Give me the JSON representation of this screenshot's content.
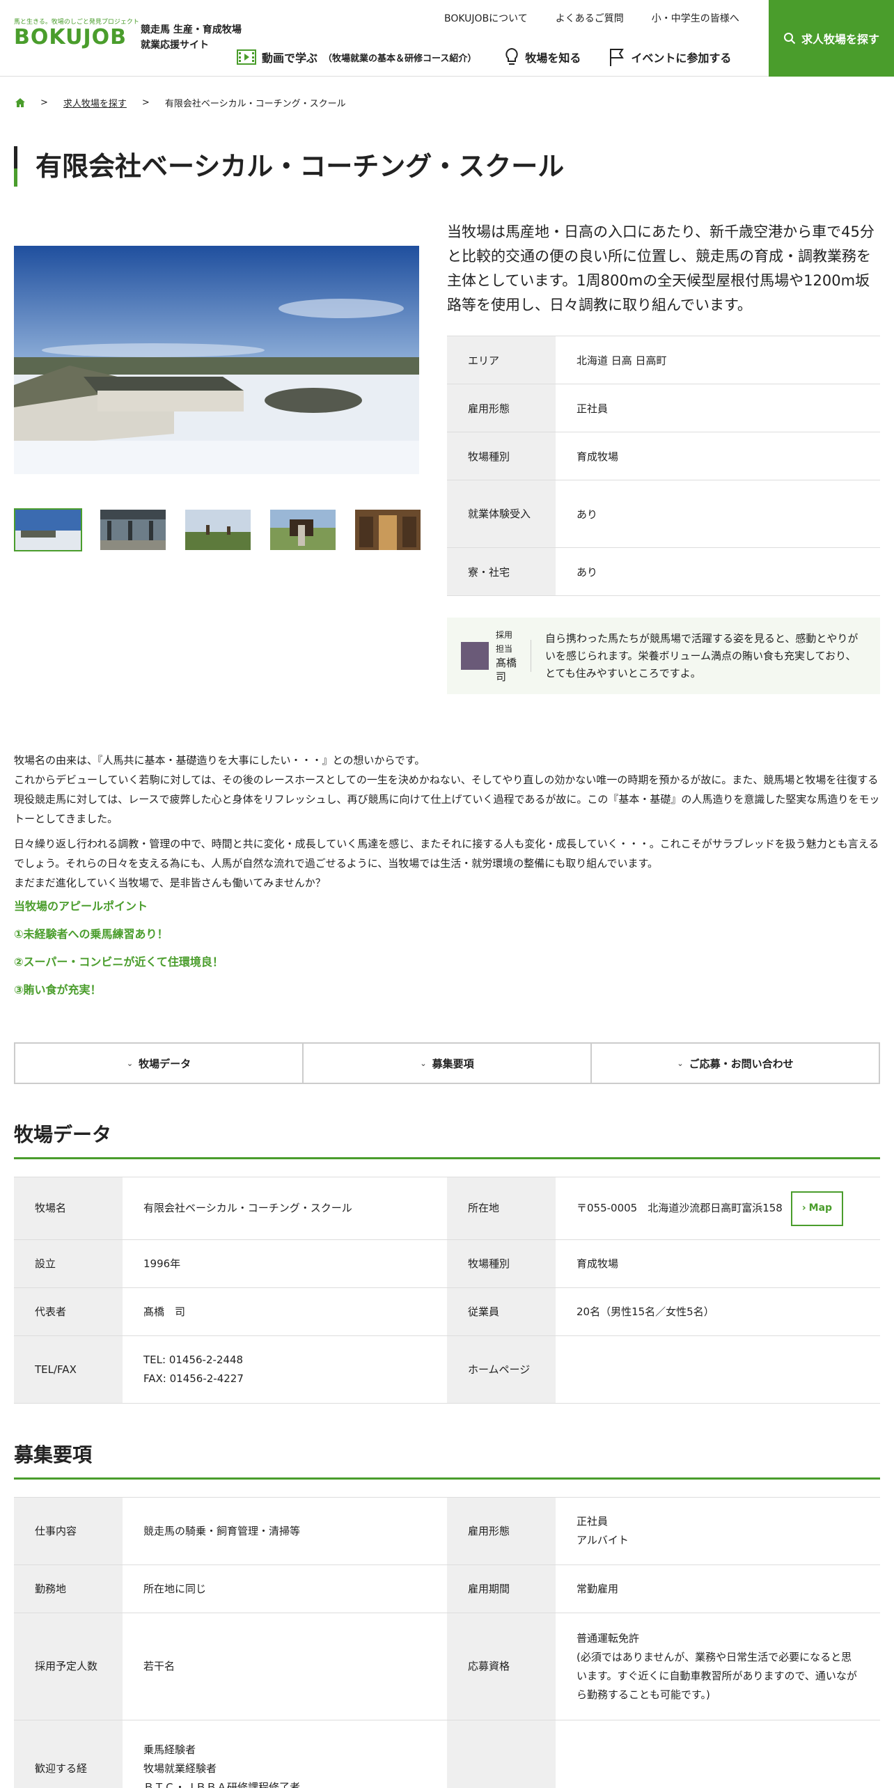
{
  "header": {
    "logo_tagline": "馬と生きる。牧場のしごと発見プロジェクト",
    "logo_text": "BOKUJOB",
    "site_line1": "競走馬 生産・育成牧場",
    "site_line2": "就業応援サイト",
    "top_links": [
      "BOKUJOBについて",
      "よくあるご質問",
      "小・中学生の皆様へ"
    ],
    "nav": {
      "video_label": "動画で学ぶ",
      "video_sub": "（牧場就業の基本＆研修コース紹介）",
      "know_label": "牧場を知る",
      "event_label": "イベントに参加する"
    },
    "search_button": "求人牧場を探す"
  },
  "breadcrumb": {
    "sep": ">",
    "link": "求人牧場を探す",
    "current": "有限会社ベーシカル・コーチング・スクール"
  },
  "title": "有限会社ベーシカル・コーチング・スクール",
  "intro": "当牧場は馬産地・日高の入口にあたり、新千歳空港から車で45分と比較的交通の便の良い所に位置し、競走馬の育成・調教業務を主体としています。1周800mの全天候型屋根付馬場や1200m坂路等を使用し、日々調教に取り組んでいます。",
  "summary": [
    {
      "label": "エリア",
      "value": "北海道 日高 日高町"
    },
    {
      "label": "雇用形態",
      "value": "正社員"
    },
    {
      "label": "牧場種別",
      "value": "育成牧場"
    },
    {
      "label": "就業体験受入",
      "value": "あり"
    },
    {
      "label": "寮・社宅",
      "value": "あり"
    }
  ],
  "staff": {
    "role": "採用担当",
    "name": "髙橋　司",
    "message": "自ら携わった馬たちが競馬場で活躍する姿を見ると、感動とやりがいを感じられます。栄養ボリューム満点の賄い食も充実しており、とても住みやすいところですよ。"
  },
  "description": {
    "p1_line1": "牧場名の由来は、『人馬共に基本・基礎造りを大事にしたい・・・』との想いからです。",
    "p1_line2": "これからデビューしていく若駒に対しては、その後のレースホースとしての一生を決めかねない、そしてやり直しの効かない唯一の時期を預かるが故に。また、競馬場と牧場を往復する現役競走馬に対しては、レースで疲弊した心と身体をリフレッシュし、再び競馬に向けて仕上げていく過程であるが故に。この『基本・基礎』の人馬造りを意識した堅実な馬造りをモットーとしてきました。",
    "p2_line1": "日々繰り返し行われる調教・管理の中で、時間と共に変化・成長していく馬達を感じ、またそれに接する人も変化・成長していく・・・。これこそがサラブレッドを扱う魅力とも言えるでしょう。それらの日々を支える為にも、人馬が自然な流れで過ごせるように、当牧場では生活・就労環境の整備にも取り組んでいます。",
    "p2_line2": "まだまだ進化していく当牧場で、是非皆さんも働いてみませんか？",
    "appeal_title": "当牧場のアピールポイント",
    "appeal_1": "①未経験者への乗馬練習あり！",
    "appeal_2": "②スーパー・コンビニが近くて住環境良！",
    "appeal_3": "③賄い食が充実！"
  },
  "tabs": [
    "牧場データ",
    "募集要項",
    "ご応募・お問い合わせ"
  ],
  "farm_data": {
    "heading": "牧場データ",
    "name_label": "牧場名",
    "name": "有限会社ベーシカル・コーチング・スクール",
    "address_label": "所在地",
    "address": "〒055-0005　北海道沙流郡日高町富浜158",
    "map_button": "Map",
    "founded_label": "設立",
    "founded": "1996年",
    "type_label": "牧場種別",
    "type": "育成牧場",
    "rep_label": "代表者",
    "rep": "髙橋　司",
    "staff_label": "従業員",
    "staff": "20名（男性15名／女性5名）",
    "tel_label": "TEL/FAX",
    "tel": "TEL: 01456-2-2448",
    "fax": "FAX: 01456-2-4227",
    "hp_label": "ホームページ",
    "hp": ""
  },
  "recruit": {
    "heading": "募集要項",
    "job_label": "仕事内容",
    "job": "競走馬の騎乗・飼育管理・清掃等",
    "emp_label": "雇用形態",
    "emp_1": "正社員",
    "emp_2": "アルバイト",
    "place_label": "勤務地",
    "place": "所在地に同じ",
    "period_label": "雇用期間",
    "period": "常勤雇用",
    "num_label": "採用予定人数",
    "num": "若干名",
    "qual_label": "応募資格",
    "qual_1": "普通運転免許",
    "qual_2": "(必須ではありませんが、業務や日常生活で必要になると思います。すぐ近くに自動車教習所がありますので、通いながら勤務することも可能です。)",
    "welcome_label": "歓迎する経",
    "welcome_1": "乗馬経験者",
    "welcome_2": "牧場就業経験者",
    "welcome_3": "ＢＴＣ・ＪＢＢＡ研修課程修了者"
  },
  "colors": {
    "accent": "#4a9d2c",
    "label_bg": "#efefef"
  }
}
